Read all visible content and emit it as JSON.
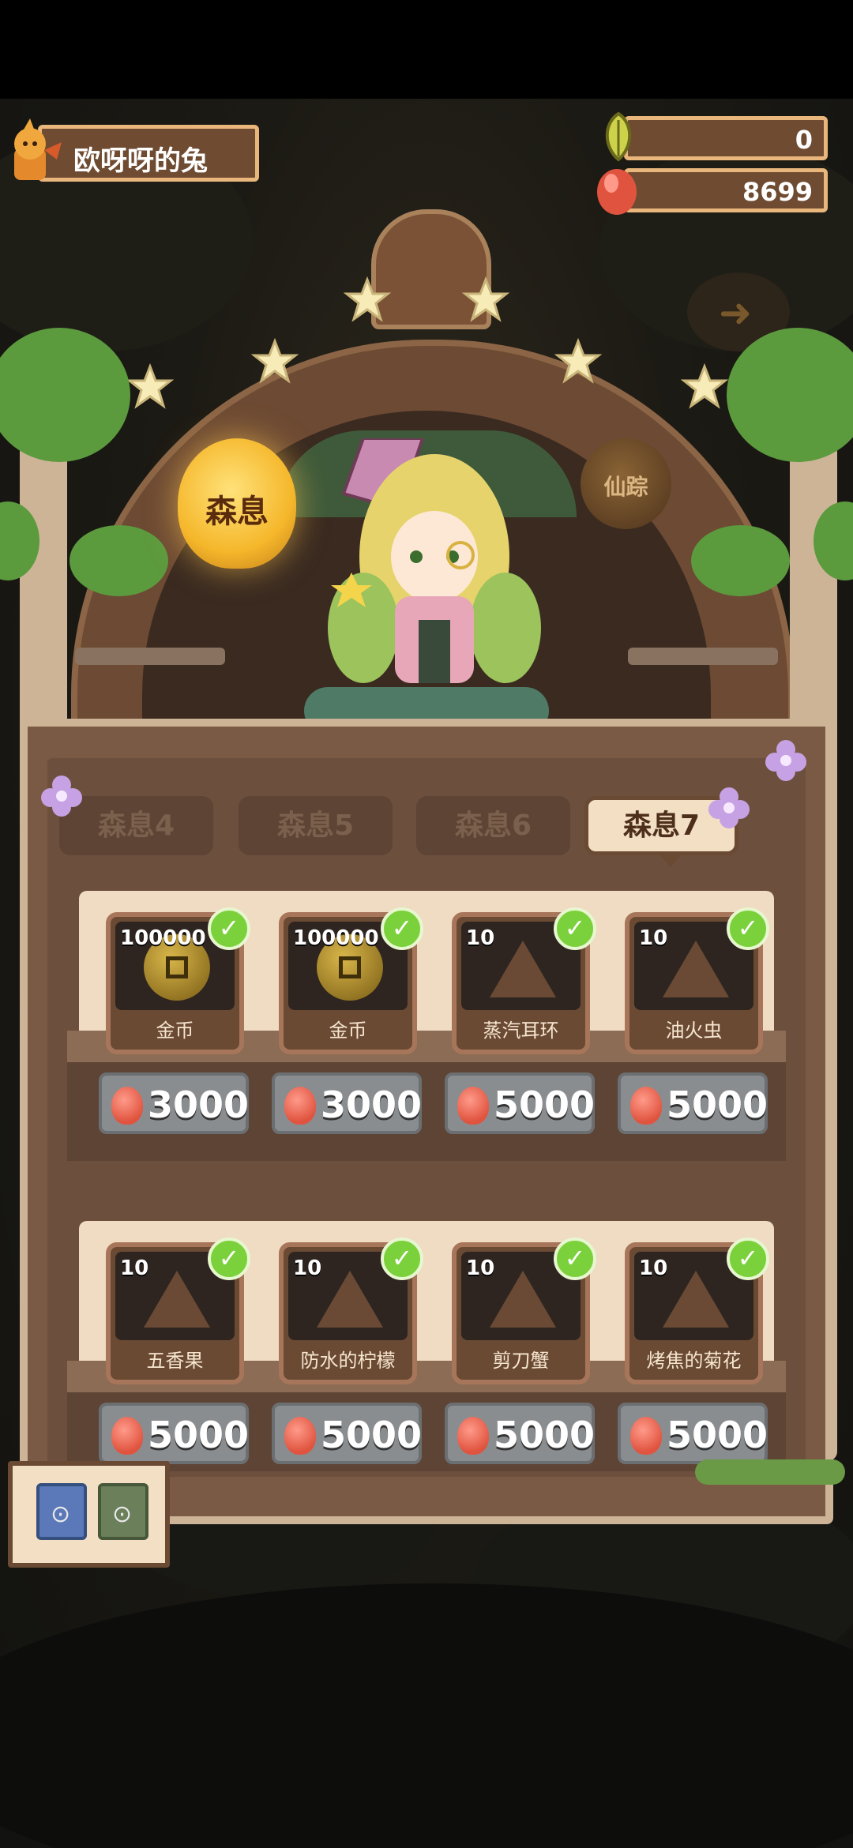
{
  "player": {
    "name": "欧呀呀的兔"
  },
  "resources": [
    {
      "icon": "leaf-icon",
      "value": "0"
    },
    {
      "icon": "egg-icon",
      "value": "8699"
    }
  ],
  "lanterns": {
    "active": "森息",
    "inactive": "仙踪"
  },
  "tabs": [
    {
      "label": "森息4",
      "active": false
    },
    {
      "label": "森息5",
      "active": false
    },
    {
      "label": "森息6",
      "active": false
    },
    {
      "label": "森息7",
      "active": true
    }
  ],
  "items": [
    {
      "qty": "100000",
      "name": "金币",
      "price": "3000",
      "icon": "coin-icon",
      "purchased": true
    },
    {
      "qty": "100000",
      "name": "金币",
      "price": "3000",
      "icon": "coin-icon",
      "purchased": true
    },
    {
      "qty": "10",
      "name": "蒸汽耳环",
      "price": "5000",
      "icon": "earring-fragment-icon",
      "purchased": true
    },
    {
      "qty": "10",
      "name": "油火虫",
      "price": "5000",
      "icon": "firefly-fragment-icon",
      "purchased": true
    },
    {
      "qty": "10",
      "name": "五香果",
      "price": "5000",
      "icon": "spice-fruit-fragment-icon",
      "purchased": true
    },
    {
      "qty": "10",
      "name": "防水的柠檬",
      "price": "5000",
      "icon": "lemon-fragment-icon",
      "purchased": true
    },
    {
      "qty": "10",
      "name": "剪刀蟹",
      "price": "5000",
      "icon": "crab-fragment-icon",
      "purchased": true
    },
    {
      "qty": "10",
      "name": "烤焦的菊花",
      "price": "5000",
      "icon": "chrysanthemum-fragment-icon",
      "purchased": true
    }
  ],
  "colors": {
    "check": "#7bd13b",
    "panel": "#7a5a44",
    "price_button": "#8a8d90",
    "lantern_gold": "#f5b72b"
  }
}
